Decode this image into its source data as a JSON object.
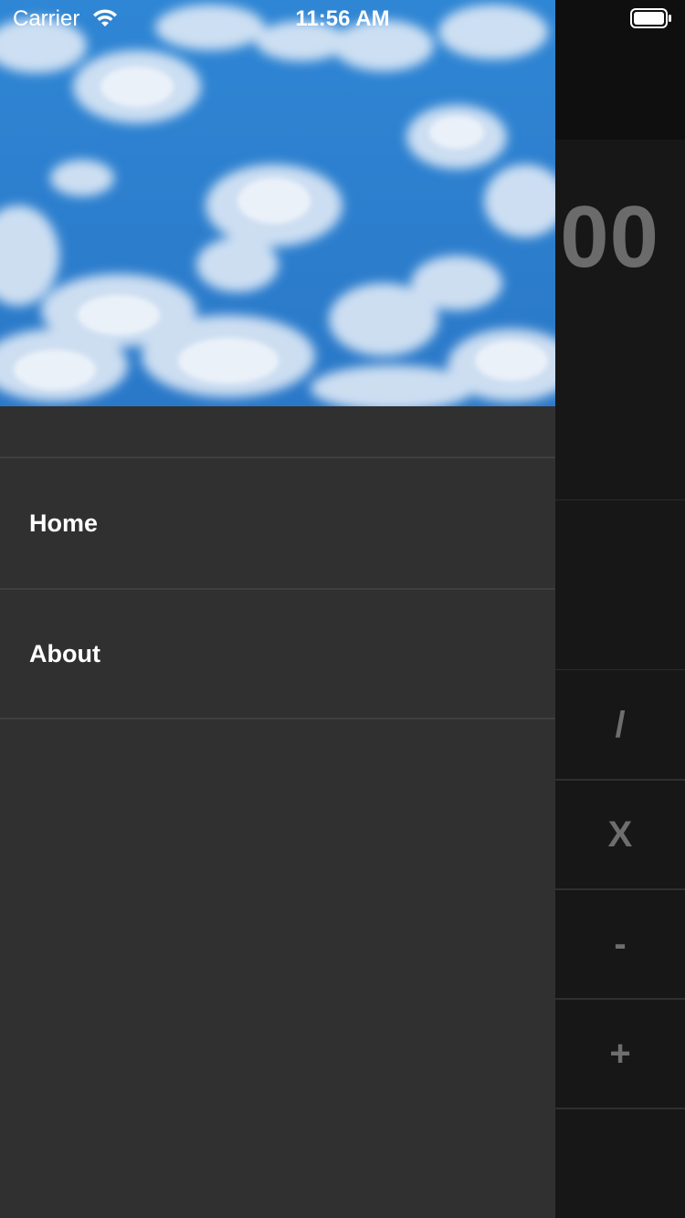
{
  "status_bar": {
    "carrier": "Carrier",
    "time": "11:56 AM"
  },
  "drawer": {
    "header_image": "sky-with-clouds",
    "menu": [
      {
        "label": "Home"
      },
      {
        "label": "About"
      }
    ]
  },
  "calculator": {
    "display": "00",
    "operators": [
      "/",
      "X",
      "-",
      "+"
    ]
  },
  "colors": {
    "drawer_bg": "#303030",
    "app_bg": "#171717",
    "sky": "#2a7fd0"
  }
}
